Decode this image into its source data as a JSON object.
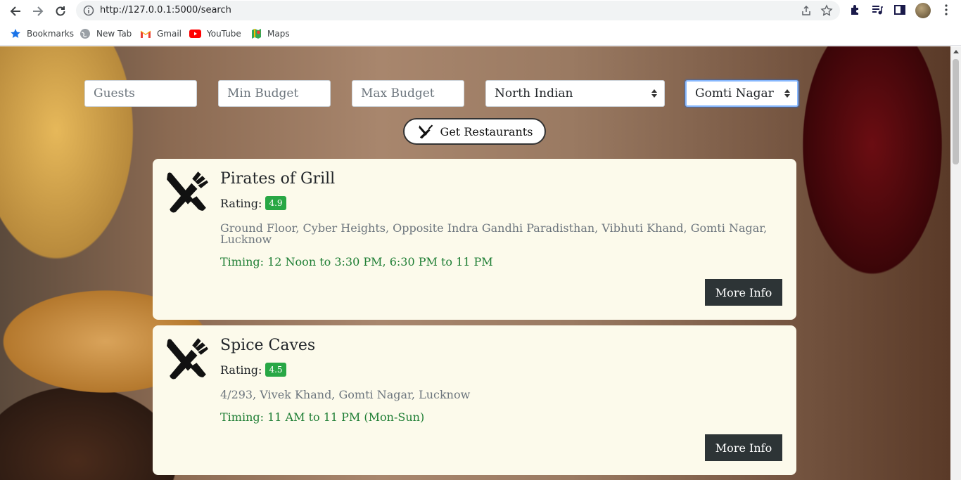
{
  "browser": {
    "url": "http://127.0.0.1:5000/search",
    "bookmarks": [
      {
        "label": "Bookmarks",
        "icon": "star-icon"
      },
      {
        "label": "New Tab",
        "icon": "globe-icon"
      },
      {
        "label": "Gmail",
        "icon": "gmail-icon"
      },
      {
        "label": "YouTube",
        "icon": "youtube-icon"
      },
      {
        "label": "Maps",
        "icon": "maps-icon"
      }
    ]
  },
  "search": {
    "guests_placeholder": "Guests",
    "min_budget_placeholder": "Min Budget",
    "max_budget_placeholder": "Max Budget",
    "cuisine_selected": "North Indian",
    "location_selected": "Gomti Nagar",
    "submit_label": "Get Restaurants"
  },
  "results": [
    {
      "name": "Pirates of Grill",
      "rating_label": "Rating:",
      "rating": "4.9",
      "address": "Ground Floor, Cyber Heights, Opposite Indra Gandhi Paradisthan, Vibhuti Khand, Gomti Nagar, Lucknow",
      "timing": "Timing: 12 Noon to 3:30 PM, 6:30 PM to 11 PM",
      "button": "More Info"
    },
    {
      "name": "Spice Caves",
      "rating_label": "Rating:",
      "rating": "4.5",
      "address": "4/293, Vivek Khand, Gomti Nagar, Lucknow",
      "timing": "Timing: 11 AM to 11 PM (Mon-Sun)",
      "button": "More Info"
    }
  ],
  "colors": {
    "badge": "#28a745",
    "timing": "#1e7e34",
    "card_bg": "#fcfaeb",
    "button_bg": "#2d3436"
  }
}
